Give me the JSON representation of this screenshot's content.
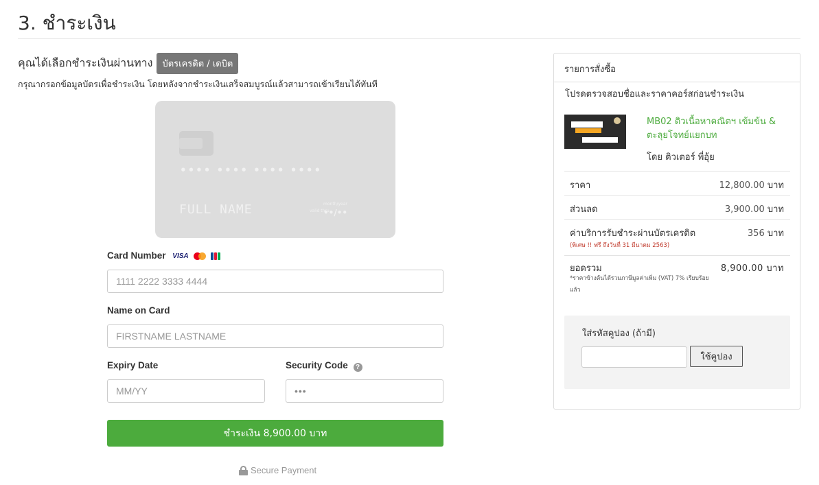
{
  "page": {
    "title": "3. ชำระเงิน",
    "method_text": "คุณได้เลือกชำระเงินผ่านทาง",
    "method_badge": "บัตรเครดิต / เดบิต",
    "instruction": "กรุณากรอกข้อมูลบัตรเพื่อชำระเงิน โดยหลังจากชำระเงินเสร็จสมบูรณ์แล้วสามารถเข้าเรียนได้ทันที"
  },
  "card_preview": {
    "number_placeholder": "•••• •••• •••• ••••",
    "name_placeholder": "FULL NAME",
    "valid_label": "valid thru",
    "month_year_label": "month/year",
    "expiry_placeholder": "••/••"
  },
  "form": {
    "card_number_label": "Card Number",
    "card_brands": [
      "VISA",
      "mastercard",
      "JCB"
    ],
    "card_number_placeholder": "1111 2222 3333 4444",
    "name_label": "Name on Card",
    "name_placeholder": "FIRSTNAME LASTNAME",
    "expiry_label": "Expiry Date",
    "expiry_placeholder": "MM/YY",
    "security_label": "Security Code",
    "security_icon": "question-circle-icon",
    "security_placeholder": "•••",
    "pay_button": "ชำระเงิน 8,900.00 บาท",
    "secure_text": "Secure Payment",
    "secure_icon": "lock-icon"
  },
  "order": {
    "heading": "รายการสั่งซื้อ",
    "note": "โปรดตรวจสอบชื่อและราคาคอร์สก่อนชำระเงิน",
    "course_title": "MB02 ติวเนื้อหาคณิตฯ เข้มข้น & ตะลุยโจทย์แยกบท",
    "course_teacher": "โดย ติวเตอร์ พี่อุ้ย",
    "rows": [
      {
        "label": "ราคา",
        "value": "12,800.00",
        "unit": "บาท"
      },
      {
        "label": "ส่วนลด",
        "value": "3,900.00",
        "unit": "บาท"
      },
      {
        "label": "ค่าบริการรับชำระผ่านบัตรเครดิต",
        "value": "356",
        "unit": "บาท",
        "note": "(พิเศษ !! ฟรี ถึงวันที่ 31 มีนาคม 2563)"
      }
    ],
    "total": {
      "label": "ยอดรวม",
      "value": "8,900.00 บาท",
      "note": "*ราคาข้างต้นได้รวมภาษีมูลค่าเพิ่ม (VAT) 7% เรียบร้อยแล้ว"
    },
    "coupon": {
      "label": "ใส่รหัสคูปอง (ถ้ามี)",
      "value": "",
      "button": "ใช้คูปอง"
    }
  },
  "colors": {
    "accent_green": "#4cab3d",
    "badge_gray": "#777777",
    "promo_red": "#c0392b",
    "card_gray": "#dddddd"
  }
}
